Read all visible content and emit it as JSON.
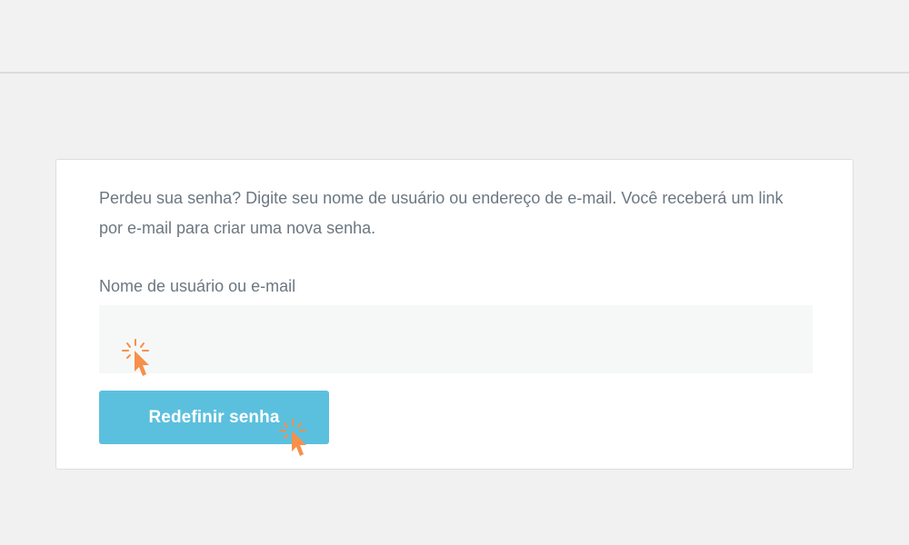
{
  "form": {
    "description": "Perdeu sua senha? Digite seu nome de usuário ou endereço de e-mail. Você receberá um link por e-mail para criar uma nova senha.",
    "field_label": "Nome de usuário ou e-mail",
    "field_value": "",
    "field_placeholder": "",
    "submit_label": "Redefinir senha"
  },
  "icons": {
    "click_indicator": "click-cursor-icon"
  },
  "colors": {
    "page_background": "#f1f1f1",
    "card_background": "#ffffff",
    "text": "#6c7781",
    "button": "#5bc0de",
    "button_text": "#ffffff",
    "input_background": "#f6f8f8",
    "cursor_accent": "#f7904a"
  }
}
